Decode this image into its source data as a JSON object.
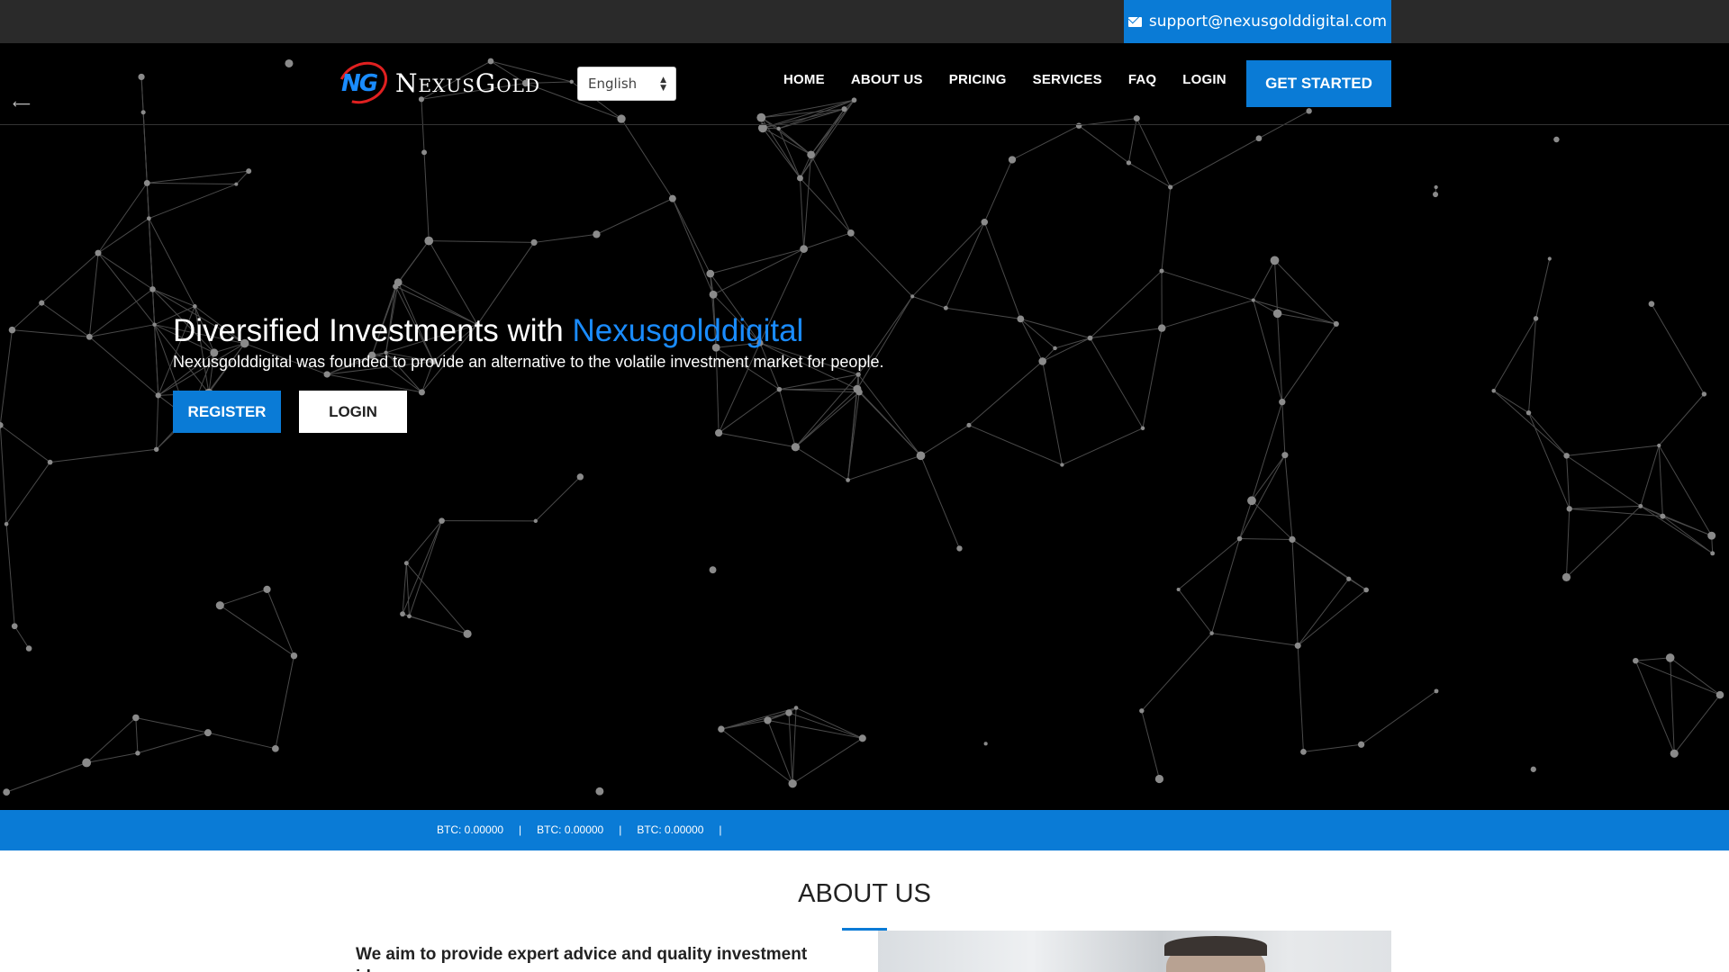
{
  "topbar": {
    "support_email": "support@nexusgolddigital.com",
    "mail_icon": "envelope-icon"
  },
  "nav": {
    "logo_mark": "NG",
    "logo_text": "NexusGold",
    "language_selected": "English",
    "menu": [
      "HOME",
      "ABOUT US",
      "PRICING",
      "SERVICES",
      "FAQ",
      "LOGIN"
    ],
    "cta": "GET STARTED"
  },
  "hero": {
    "title_prefix": "Diversified Investments with",
    "title_brand": "Nexusgolddigital",
    "subtitle": "Nexusgolddigital was founded to provide an alternative to the volatile investment market for people.",
    "register_label": "REGISTER",
    "login_label": "LOGIN",
    "back_arrow": "⟵"
  },
  "ticker": {
    "items": [
      "BTC: 0.00000",
      "BTC: 0.00000",
      "BTC: 0.00000"
    ],
    "separator": "|"
  },
  "about": {
    "title": "ABOUT US",
    "lead": "We aim to provide expert advice and quality investment ideas."
  },
  "colors": {
    "accent": "#0a7bd6",
    "brand_text": "#1a8cff",
    "topbar": "#2a2a2a",
    "hero_bg": "#000000"
  }
}
